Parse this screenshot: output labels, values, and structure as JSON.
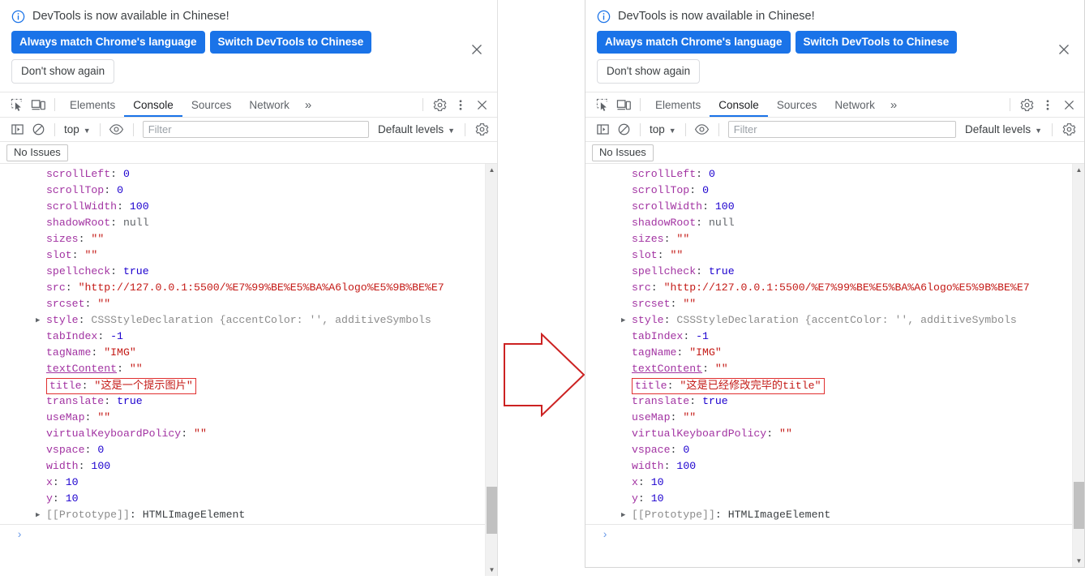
{
  "banner": {
    "info_icon": "info-circle-icon",
    "message": "DevTools is now available in Chinese!",
    "primary_button": "Always match Chrome's language",
    "secondary_button": "Switch DevTools to Chinese",
    "dismiss_button": "Don't show again",
    "close_icon": "close-icon"
  },
  "tabstrip": {
    "inspect_icon": "inspect-cursor-icon",
    "device_icon": "device-toolbar-icon",
    "tabs": [
      {
        "label": "Elements",
        "active": false
      },
      {
        "label": "Console",
        "active": true
      },
      {
        "label": "Sources",
        "active": false
      },
      {
        "label": "Network",
        "active": false
      }
    ],
    "more_tabs": "»",
    "settings_icon": "gear-icon",
    "menu_icon": "kebab-menu-icon",
    "close_icon": "close-icon"
  },
  "consolebar": {
    "sidebar_icon": "console-sidebar-icon",
    "clear_icon": "clear-console-icon",
    "context": "top",
    "caret": "▼",
    "eye_icon": "eye-icon",
    "filter_placeholder": "Filter",
    "filter_value": "",
    "levels": "Default levels",
    "settings_icon": "gear-icon"
  },
  "issuesbar": {
    "label": "No Issues"
  },
  "colors": {
    "accent": "#1a73e8",
    "key": "#a233a2",
    "string": "#c41a16",
    "number": "#1c00cf",
    "gray": "#8c8c8c",
    "highlight_box": "#e03030"
  },
  "console_left": {
    "properties": [
      {
        "key": "scrollLeft",
        "sep": ": ",
        "value": "0",
        "vtype": "num",
        "expand": false,
        "underline": false
      },
      {
        "key": "scrollTop",
        "sep": ": ",
        "value": "0",
        "vtype": "num",
        "expand": false,
        "underline": false
      },
      {
        "key": "scrollWidth",
        "sep": ": ",
        "value": "100",
        "vtype": "num",
        "expand": false,
        "underline": false
      },
      {
        "key": "shadowRoot",
        "sep": ": ",
        "value": "null",
        "vtype": "nul",
        "expand": false,
        "underline": false
      },
      {
        "key": "sizes",
        "sep": ": ",
        "value": "\"\"",
        "vtype": "str",
        "expand": false,
        "underline": false
      },
      {
        "key": "slot",
        "sep": ": ",
        "value": "\"\"",
        "vtype": "str",
        "expand": false,
        "underline": false
      },
      {
        "key": "spellcheck",
        "sep": ": ",
        "value": "true",
        "vtype": "bool",
        "expand": false,
        "underline": false
      },
      {
        "key": "src",
        "sep": ": ",
        "value": "\"http://127.0.0.1:5500/%E7%99%BE%E5%BA%A6logo%E5%9B%BE%E7",
        "vtype": "str",
        "expand": false,
        "underline": false,
        "clip": true
      },
      {
        "key": "srcset",
        "sep": ": ",
        "value": "\"\"",
        "vtype": "str",
        "expand": false,
        "underline": false
      },
      {
        "key": "style",
        "sep": ": ",
        "value": "CSSStyleDeclaration {accentColor: '', additiveSymbols",
        "vtype": "obj",
        "expand": true,
        "underline": false
      },
      {
        "key": "tabIndex",
        "sep": ": ",
        "value": "-1",
        "vtype": "num",
        "expand": false,
        "underline": false
      },
      {
        "key": "tagName",
        "sep": ": ",
        "value": "\"IMG\"",
        "vtype": "str",
        "expand": false,
        "underline": false
      },
      {
        "key": "textContent",
        "sep": ": ",
        "value": "\"\"",
        "vtype": "str",
        "expand": false,
        "underline": true
      }
    ],
    "highlighted": {
      "key": "title",
      "sep": ": ",
      "value": "\"这是一个提示图片\""
    },
    "properties_after": [
      {
        "key": "translate",
        "sep": ": ",
        "value": "true",
        "vtype": "bool",
        "expand": false,
        "underline": false
      },
      {
        "key": "useMap",
        "sep": ": ",
        "value": "\"\"",
        "vtype": "str",
        "expand": false,
        "underline": false
      },
      {
        "key": "virtualKeyboardPolicy",
        "sep": ": ",
        "value": "\"\"",
        "vtype": "str",
        "expand": false,
        "underline": false
      },
      {
        "key": "vspace",
        "sep": ": ",
        "value": "0",
        "vtype": "num",
        "expand": false,
        "underline": false
      },
      {
        "key": "width",
        "sep": ": ",
        "value": "100",
        "vtype": "num",
        "expand": false,
        "underline": false
      },
      {
        "key": "x",
        "sep": ": ",
        "value": "10",
        "vtype": "num",
        "expand": false,
        "underline": false
      },
      {
        "key": "y",
        "sep": ": ",
        "value": "10",
        "vtype": "num",
        "expand": false,
        "underline": false
      }
    ],
    "prototype": {
      "key": "[[Prototype]]",
      "sep": ": ",
      "value": "HTMLImageElement"
    },
    "prompt": "›"
  },
  "console_right": {
    "highlighted": {
      "key": "title",
      "sep": ": ",
      "value": "\"这是已经修改完毕的title\""
    }
  },
  "flow_arrow": {
    "icon": "right-arrow-annotation",
    "color": "#cc2222"
  }
}
